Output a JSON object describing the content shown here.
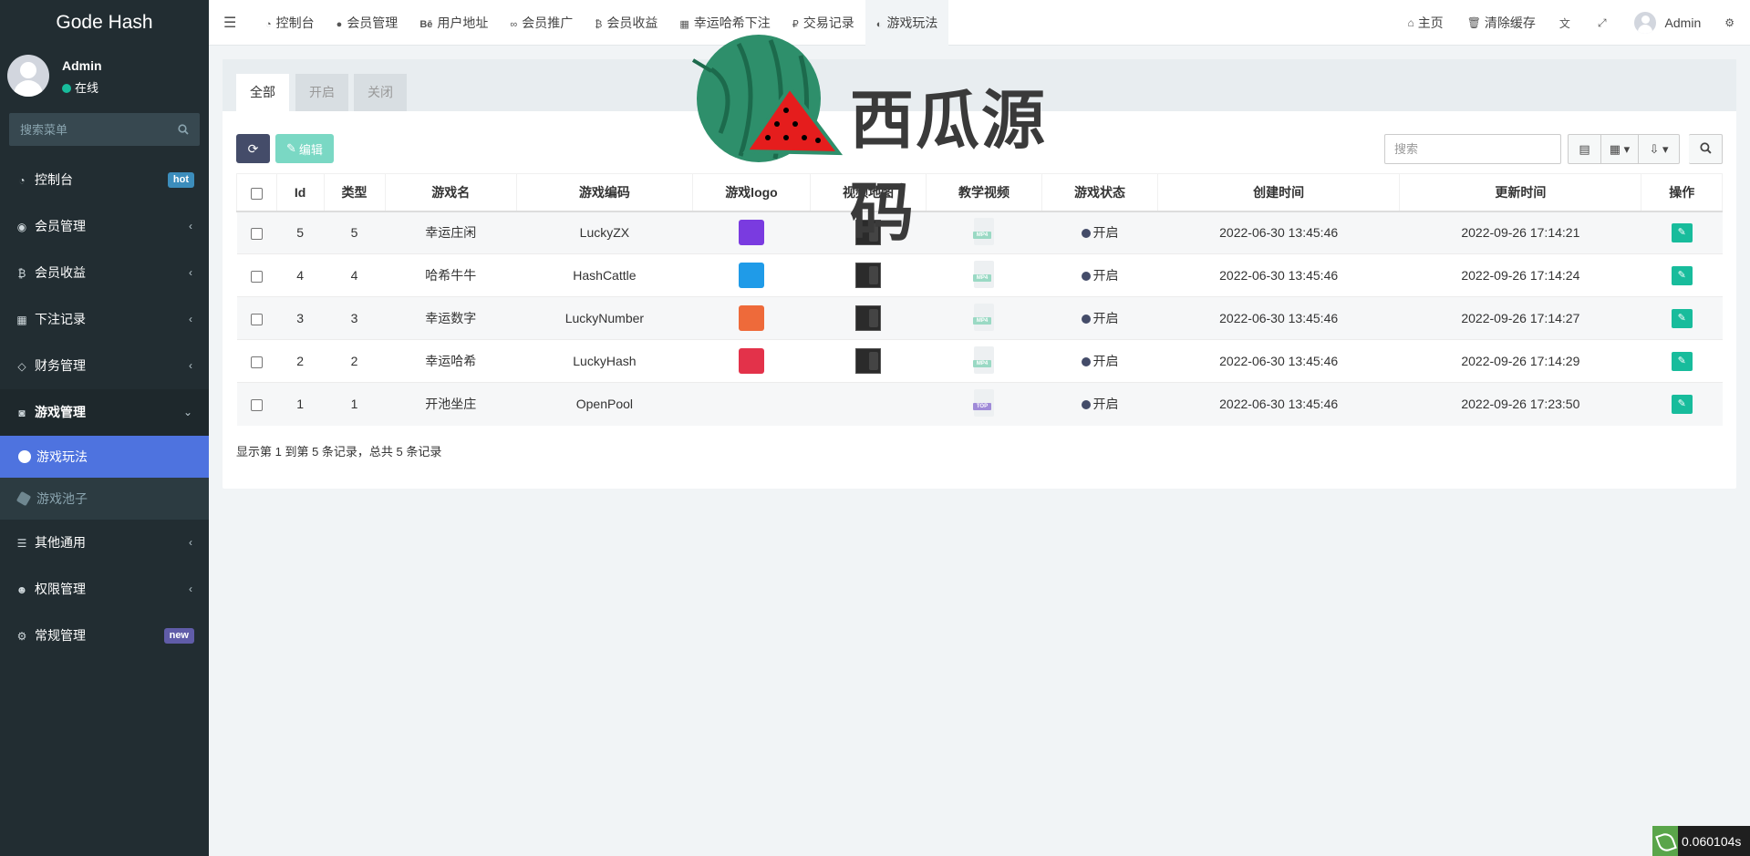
{
  "app": {
    "brand": "Gode Hash"
  },
  "user": {
    "name": "Admin",
    "status": "在线"
  },
  "sidebar": {
    "search_placeholder": "搜索菜单",
    "items": [
      {
        "label": "控制台",
        "icon": "dashboard-icon",
        "badge": "hot"
      },
      {
        "label": "会员管理",
        "icon": "user-circle-icon"
      },
      {
        "label": "会员收益",
        "icon": "bitcoin-icon"
      },
      {
        "label": "下注记录",
        "icon": "calendar-icon"
      },
      {
        "label": "财务管理",
        "icon": "diamond-icon"
      },
      {
        "label": "游戏管理",
        "icon": "gamepad-icon"
      },
      {
        "label": "其他通用",
        "icon": "list-icon"
      },
      {
        "label": "权限管理",
        "icon": "users-icon"
      },
      {
        "label": "常规管理",
        "icon": "cogs-icon",
        "badge": "new"
      }
    ],
    "submenu": [
      {
        "label": "游戏玩法",
        "active": true
      },
      {
        "label": "游戏池子"
      }
    ]
  },
  "topbar": {
    "tabs": [
      {
        "label": "控制台"
      },
      {
        "label": "会员管理"
      },
      {
        "label": "用户地址"
      },
      {
        "label": "会员推广"
      },
      {
        "label": "会员收益"
      },
      {
        "label": "幸运哈希下注"
      },
      {
        "label": "交易记录"
      },
      {
        "label": "游戏玩法"
      }
    ],
    "home": "主页",
    "clear_cache": "清除缓存",
    "admin": "Admin"
  },
  "panel": {
    "tabs": [
      "全部",
      "开启",
      "关闭"
    ],
    "edit_label": "编辑",
    "search_placeholder": "搜索"
  },
  "table": {
    "headers": [
      "Id",
      "类型",
      "游戏名",
      "游戏编码",
      "游戏logo",
      "视频地图",
      "教学视频",
      "游戏状态",
      "创建时间",
      "更新时间",
      "操作"
    ],
    "rows": [
      {
        "id": "5",
        "type": "5",
        "name": "幸运庄闲",
        "code": "LuckyZX",
        "logo_color": "#7a3be0",
        "map": true,
        "video": "MP4",
        "status": "开启",
        "created": "2022-06-30 13:45:46",
        "updated": "2022-09-26 17:14:21"
      },
      {
        "id": "4",
        "type": "4",
        "name": "哈希牛牛",
        "code": "HashCattle",
        "logo_color": "#1f9be8",
        "map": true,
        "video": "MP4",
        "status": "开启",
        "created": "2022-06-30 13:45:46",
        "updated": "2022-09-26 17:14:24"
      },
      {
        "id": "3",
        "type": "3",
        "name": "幸运数字",
        "code": "LuckyNumber",
        "logo_color": "#ee6a3a",
        "map": true,
        "video": "MP4",
        "status": "开启",
        "created": "2022-06-30 13:45:46",
        "updated": "2022-09-26 17:14:27"
      },
      {
        "id": "2",
        "type": "2",
        "name": "幸运哈希",
        "code": "LuckyHash",
        "logo_color": "#e3324a",
        "map": true,
        "video": "MP4",
        "status": "开启",
        "created": "2022-06-30 13:45:46",
        "updated": "2022-09-26 17:14:29"
      },
      {
        "id": "1",
        "type": "1",
        "name": "开池坐庄",
        "code": "OpenPool",
        "logo_color": "",
        "map": false,
        "video": "TOP",
        "status": "开启",
        "created": "2022-06-30 13:45:46",
        "updated": "2022-09-26 17:23:50"
      }
    ],
    "summary": "显示第 1 到第 5 条记录，总共 5 条记录"
  },
  "watermark": {
    "text": "西瓜源码"
  },
  "timer": "0.060104s"
}
